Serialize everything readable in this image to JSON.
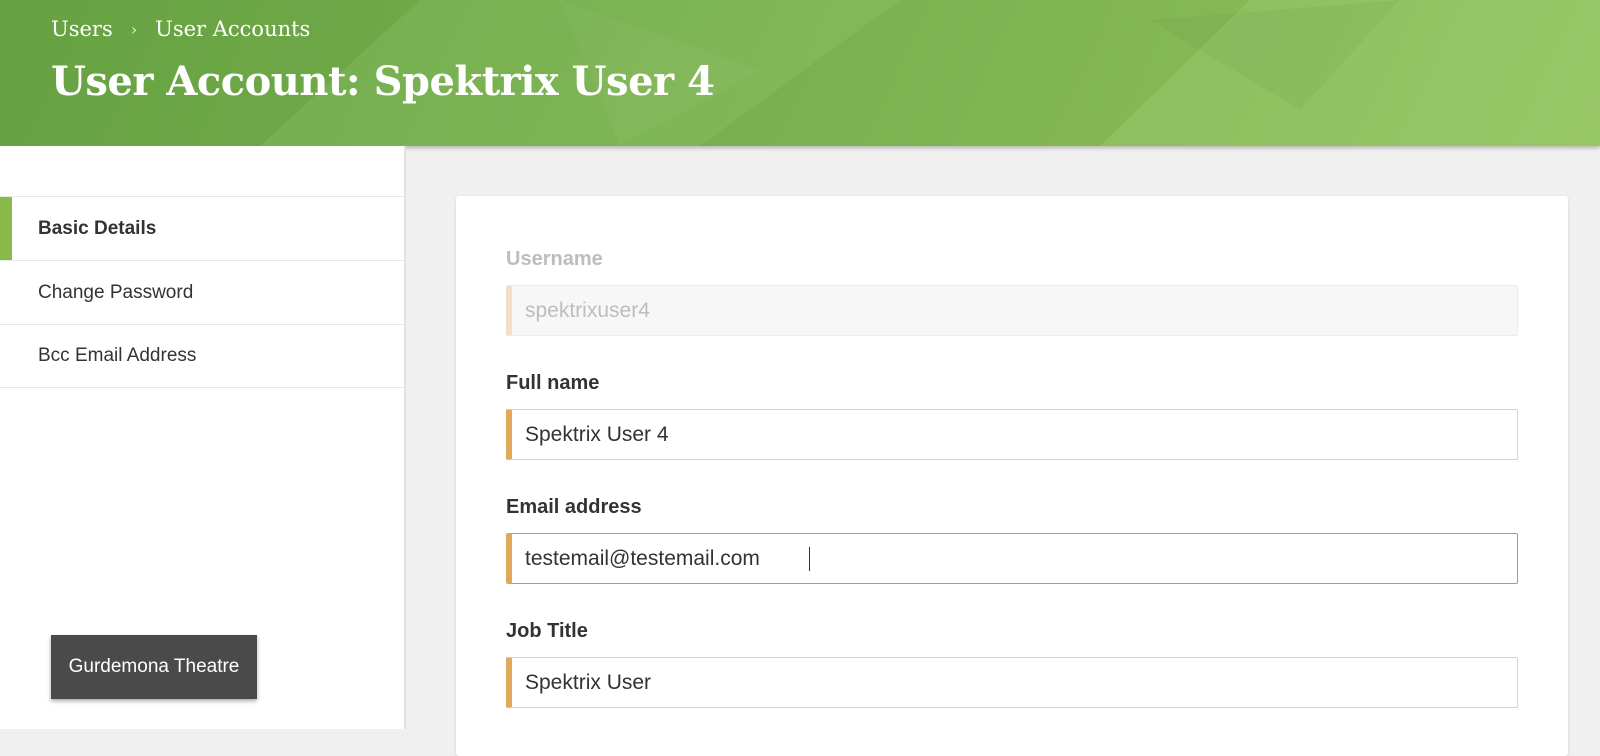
{
  "header": {
    "breadcrumb": [
      {
        "label": "Users"
      },
      {
        "label": "User Accounts"
      }
    ],
    "breadcrumb_separator": "›",
    "title_prefix": "User Account:",
    "title_name": "Spektrix User 4",
    "colors": {
      "green_dark": "#6aa845",
      "green_light": "#93c45e"
    }
  },
  "sidebar": {
    "items": [
      {
        "label": "Basic Details",
        "active": true
      },
      {
        "label": "Change Password",
        "active": false
      },
      {
        "label": "Bcc Email Address",
        "active": false
      }
    ],
    "active_color": "#8ab94b",
    "org_button_label": "Gurdemona Theatre"
  },
  "form": {
    "username": {
      "label": "Username",
      "value": "spektrixuser4",
      "disabled": true
    },
    "full_name": {
      "label": "Full name",
      "value": "Spektrix User 4"
    },
    "email": {
      "label": "Email address",
      "value": "testemail@testemail.com",
      "focused": true
    },
    "job_title": {
      "label": "Job Title",
      "value": "Spektrix User"
    },
    "required_marker_color": "#e0a85a"
  }
}
